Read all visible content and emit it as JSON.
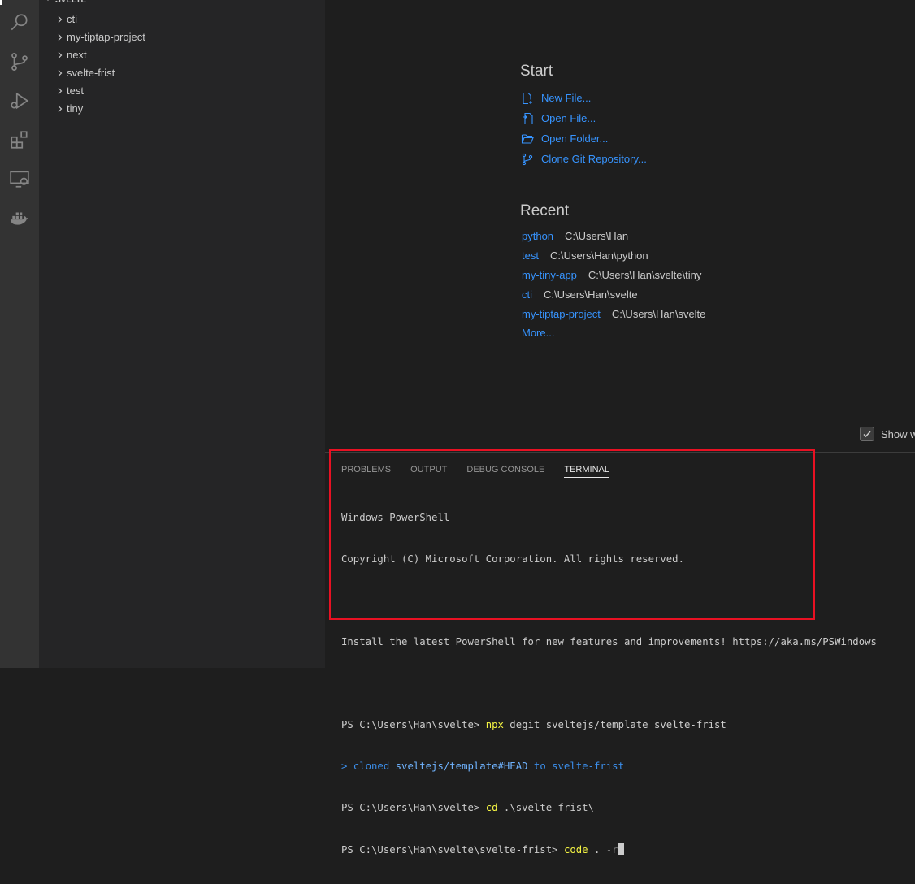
{
  "explorer": {
    "section_title": "SVELTE",
    "folders": [
      {
        "label": "cti"
      },
      {
        "label": "my-tiptap-project"
      },
      {
        "label": "next"
      },
      {
        "label": "svelte-frist"
      },
      {
        "label": "test"
      },
      {
        "label": "tiny"
      }
    ]
  },
  "activity_bar": {
    "icons": [
      "search-icon",
      "source-control-icon",
      "run-debug-icon",
      "extensions-icon",
      "remote-explorer-icon",
      "docker-icon"
    ]
  },
  "welcome": {
    "start_heading": "Start",
    "start_items": [
      {
        "label": "New File...",
        "icon": "new-file-icon"
      },
      {
        "label": "Open File...",
        "icon": "open-file-icon"
      },
      {
        "label": "Open Folder...",
        "icon": "open-folder-icon"
      },
      {
        "label": "Clone Git Repository...",
        "icon": "git-clone-icon"
      }
    ],
    "recent_heading": "Recent",
    "recent_items": [
      {
        "name": "python",
        "path": "C:\\Users\\Han"
      },
      {
        "name": "test",
        "path": "C:\\Users\\Han\\python"
      },
      {
        "name": "my-tiny-app",
        "path": "C:\\Users\\Han\\svelte\\tiny"
      },
      {
        "name": "cti",
        "path": "C:\\Users\\Han\\svelte"
      },
      {
        "name": "my-tiptap-project",
        "path": "C:\\Users\\Han\\svelte"
      }
    ],
    "more_label": "More...",
    "show_welcome_label": "Show w"
  },
  "panel": {
    "tabs": [
      "PROBLEMS",
      "OUTPUT",
      "DEBUG CONSOLE",
      "TERMINAL"
    ],
    "active_tab": "TERMINAL",
    "terminal": {
      "line1": "Windows PowerShell",
      "line2": "Copyright (C) Microsoft Corporation. All rights reserved.",
      "line3": "Install the latest PowerShell for new features and improvements! https://aka.ms/PSWindows",
      "cmd1_prompt": "PS C:\\Users\\Han\\svelte> ",
      "cmd1_exe": "npx",
      "cmd1_args": " degit sveltejs/template svelte-frist",
      "out_prefix": "> cloned ",
      "out_repo": "sveltejs/template#HEAD",
      "out_suffix": " to svelte-frist",
      "cmd2_prompt": "PS C:\\Users\\Han\\svelte> ",
      "cmd2_exe": "cd",
      "cmd2_args": " .\\svelte-frist\\",
      "cmd3_prompt": "PS C:\\Users\\Han\\svelte\\svelte-frist> ",
      "cmd3_exe": "code",
      "cmd3_args": " . ",
      "cmd3_hint": "-r"
    }
  },
  "colors": {
    "link": "#3794ff",
    "highlight_border": "#e81123",
    "terminal_yellow": "#f5f543",
    "terminal_blue": "#3b8eea"
  }
}
